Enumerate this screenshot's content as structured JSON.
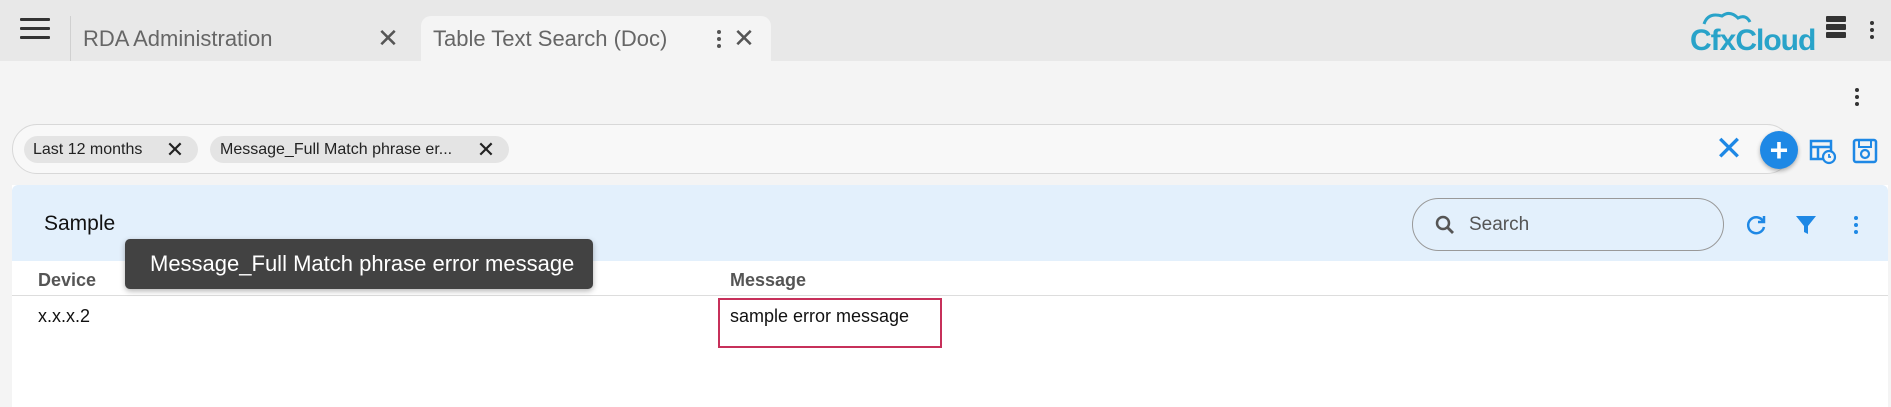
{
  "topbar": {
    "tabs": [
      {
        "label": "RDA Administration",
        "active": false
      },
      {
        "label": "Table Text Search (Doc)",
        "active": true
      }
    ],
    "logo_text": "CfxCloud",
    "icons": {
      "menu": "hamburger-icon",
      "server": "server-icon",
      "more": "more-vert-icon"
    }
  },
  "filters": {
    "chips": [
      {
        "label": "Last 12 months"
      },
      {
        "label": "Message_Full Match phrase er..."
      }
    ],
    "tooltip": "Message_Full Match phrase error message",
    "accent": "#1e88e5"
  },
  "card": {
    "title": "Sample",
    "search_placeholder": "Search",
    "columns": [
      "Device",
      "Message"
    ],
    "rows": [
      {
        "device": "x.x.x.2",
        "message": "sample error message"
      }
    ],
    "header_bg": "#e3f0fc",
    "highlight_color": "#c7305a"
  }
}
